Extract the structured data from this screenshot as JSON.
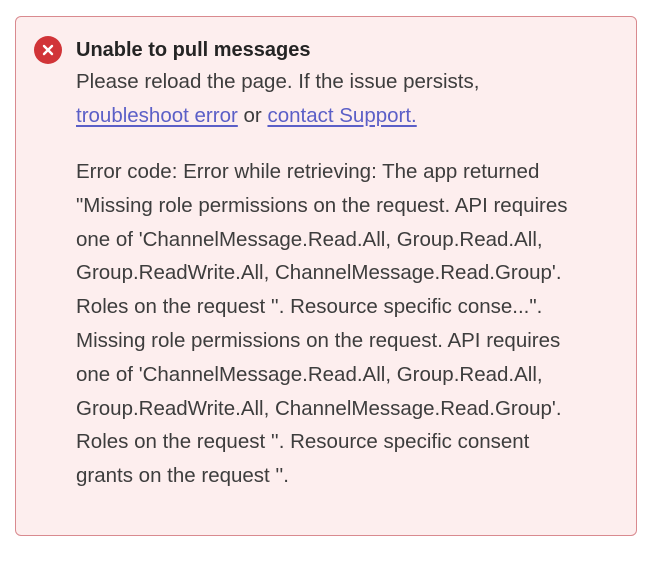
{
  "banner": {
    "title": "Unable to pull messages",
    "message_prefix": "Please reload the page. If the issue persists,",
    "troubleshoot_link": "troubleshoot error",
    "conjunction": "or",
    "support_link": "contact Support.",
    "error_details": "Error code: Error while retrieving: The app returned\n\"Missing role permissions on the request. API requires\none of 'ChannelMessage.Read.All, Group.Read.All,\nGroup.ReadWrite.All, ChannelMessage.Read.Group'.\nRoles on the request ''. Resource specific conse...\".\nMissing role permissions on the request. API requires\none of 'ChannelMessage.Read.All, Group.Read.All,\nGroup.ReadWrite.All, ChannelMessage.Read.Group'.\nRoles on the request ''. Resource specific consent\ngrants on the request ''.",
    "icon": "error-circle-icon",
    "colors": {
      "background": "#fdeeee",
      "border": "#d98a8f",
      "icon": "#d13438",
      "link": "#5b5fc7"
    }
  }
}
